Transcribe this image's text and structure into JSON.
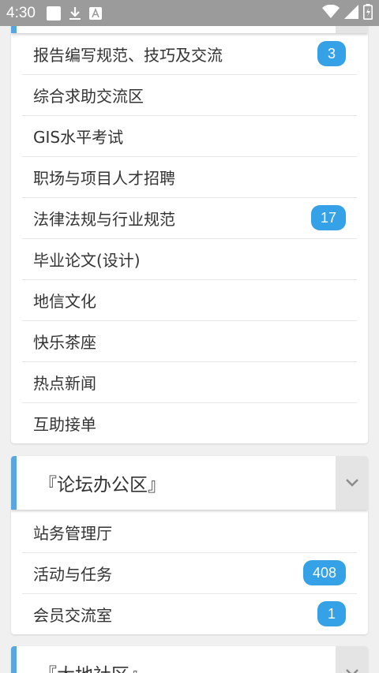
{
  "status_bar": {
    "time": "4:30"
  },
  "sections": [
    {
      "items": [
        {
          "label": "报告编写规范、技巧及交流",
          "badge": "3"
        },
        {
          "label": "综合求助交流区",
          "badge": null
        },
        {
          "label": "GIS水平考试",
          "badge": null
        },
        {
          "label": "职场与项目人才招聘",
          "badge": null
        },
        {
          "label": "法律法规与行业规范",
          "badge": "17"
        },
        {
          "label": "毕业论文(设计)",
          "badge": null
        },
        {
          "label": "地信文化",
          "badge": null
        },
        {
          "label": "快乐茶座",
          "badge": null
        },
        {
          "label": "热点新闻",
          "badge": null
        },
        {
          "label": "互助接单",
          "badge": null
        }
      ]
    },
    {
      "title": "『论坛办公区』",
      "items": [
        {
          "label": "站务管理厅",
          "badge": null
        },
        {
          "label": "活动与任务",
          "badge": "408"
        },
        {
          "label": "会员交流室",
          "badge": "1"
        }
      ]
    },
    {
      "title": "『大地社区』",
      "items": []
    }
  ],
  "colors": {
    "accent": "#5aa7e0",
    "badge": "#35a1e6",
    "status_bar": "#9b9b9b"
  }
}
